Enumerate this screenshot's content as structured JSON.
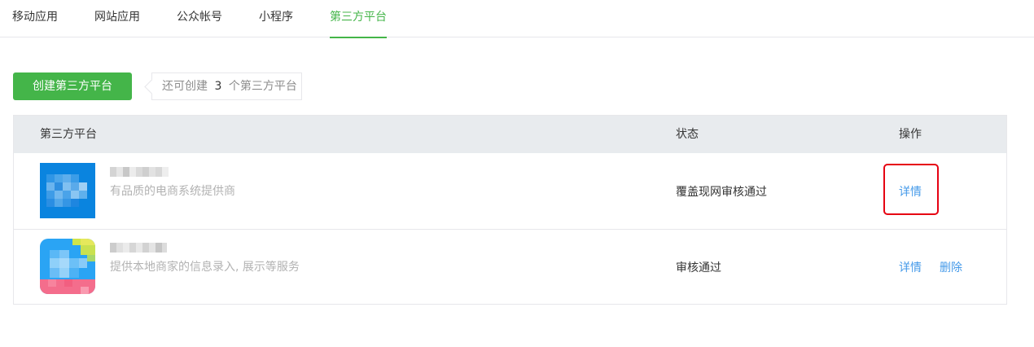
{
  "tabs": [
    {
      "label": "移动应用"
    },
    {
      "label": "网站应用"
    },
    {
      "label": "公众帐号"
    },
    {
      "label": "小程序"
    },
    {
      "label": "第三方平台"
    }
  ],
  "active_tab": "第三方平台",
  "create_button": {
    "label": "创建第三方平台"
  },
  "tip": {
    "prefix": "还可创建",
    "count": "3",
    "suffix": "个第三方平台"
  },
  "table": {
    "headers": {
      "platform": "第三方平台",
      "status": "状态",
      "action": "操作"
    },
    "rows": [
      {
        "desc": "有品质的电商系统提供商",
        "status": "覆盖现网审核通过",
        "detail": "详情"
      },
      {
        "desc": "提供本地商家的信息录入, 展示等服务",
        "status": "审核通过",
        "detail": "详情",
        "delete": "删除"
      }
    ]
  },
  "colors": {
    "accent": "#44b549",
    "link": "#459ae9",
    "highlight": "#e60012"
  }
}
